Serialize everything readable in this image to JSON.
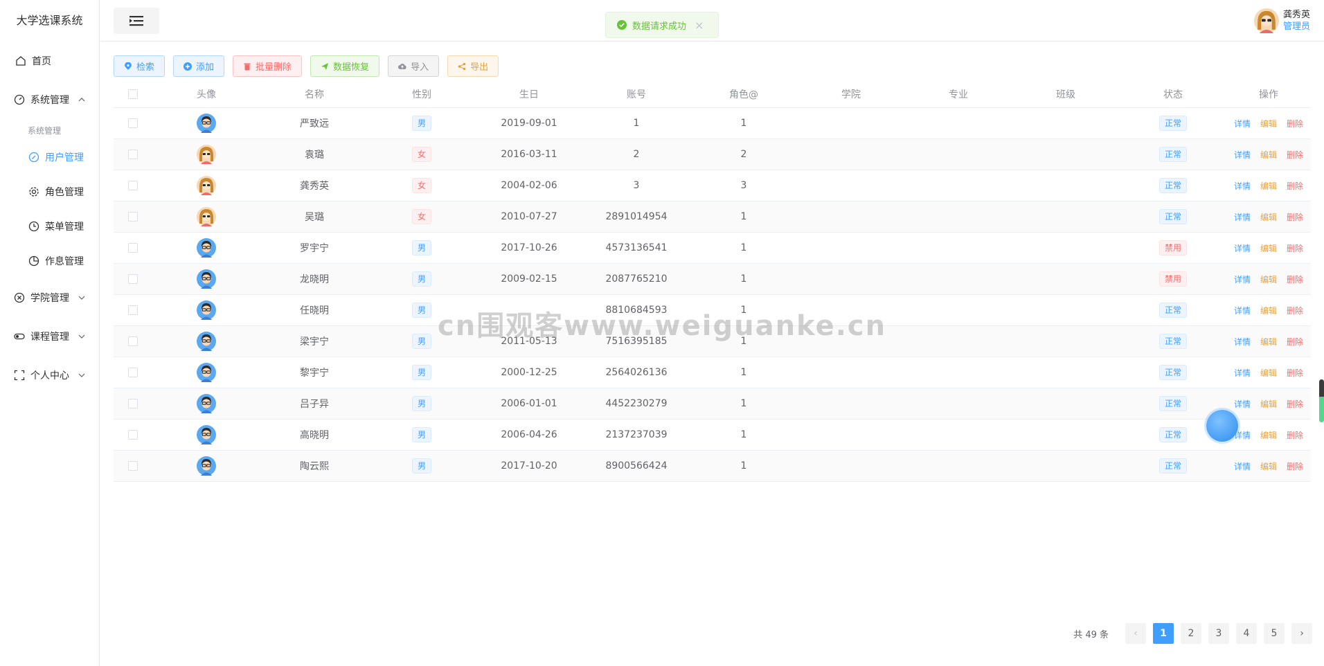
{
  "brand": "大学选课系统",
  "sidebar": {
    "home": "首页",
    "system": "系统管理",
    "system_group_label": "系统管理",
    "user_mgmt": "用户管理",
    "role_mgmt": "角色管理",
    "menu_mgmt": "菜单管理",
    "schedule_mgmt": "作息管理",
    "college_mgmt": "学院管理",
    "course_mgmt": "课程管理",
    "personal": "个人中心"
  },
  "header": {
    "user_name": "龚秀英",
    "user_role": "管理员"
  },
  "toast": {
    "message": "数据请求成功",
    "close": "×"
  },
  "toolbar": {
    "search": "检索",
    "add": "添加",
    "batch_delete": "批量删除",
    "restore": "数据恢复",
    "import": "导入",
    "export": "导出"
  },
  "table": {
    "columns": [
      "头像",
      "名称",
      "性别",
      "生日",
      "账号",
      "角色@",
      "学院",
      "专业",
      "班级",
      "状态",
      "操作"
    ],
    "actions": {
      "detail": "详情",
      "edit": "编辑",
      "delete": "删除"
    },
    "rows": [
      {
        "name": "严致远",
        "gender": "男",
        "birthday": "2019-09-01",
        "account": "1",
        "role": "1",
        "status": "正常"
      },
      {
        "name": "袁璐",
        "gender": "女",
        "birthday": "2016-03-11",
        "account": "2",
        "role": "2",
        "status": "正常"
      },
      {
        "name": "龚秀英",
        "gender": "女",
        "birthday": "2004-02-06",
        "account": "3",
        "role": "3",
        "status": "正常"
      },
      {
        "name": "吴璐",
        "gender": "女",
        "birthday": "2010-07-27",
        "account": "2891014954",
        "role": "1",
        "status": "正常"
      },
      {
        "name": "罗宇宁",
        "gender": "男",
        "birthday": "2017-10-26",
        "account": "4573136541",
        "role": "1",
        "status": "禁用"
      },
      {
        "name": "龙晓明",
        "gender": "男",
        "birthday": "2009-02-15",
        "account": "2087765210",
        "role": "1",
        "status": "禁用"
      },
      {
        "name": "任晓明",
        "gender": "男",
        "birthday": "",
        "account": "8810684593",
        "role": "1",
        "status": "正常"
      },
      {
        "name": "梁宇宁",
        "gender": "男",
        "birthday": "2011-05-13",
        "account": "7516395185",
        "role": "1",
        "status": "正常"
      },
      {
        "name": "黎宇宁",
        "gender": "男",
        "birthday": "2000-12-25",
        "account": "2564026136",
        "role": "1",
        "status": "正常"
      },
      {
        "name": "吕子异",
        "gender": "男",
        "birthday": "2006-01-01",
        "account": "4452230279",
        "role": "1",
        "status": "正常"
      },
      {
        "name": "高晓明",
        "gender": "男",
        "birthday": "2006-04-26",
        "account": "2137237039",
        "role": "1",
        "status": "正常"
      },
      {
        "name": "陶云熙",
        "gender": "男",
        "birthday": "2017-10-20",
        "account": "8900566424",
        "role": "1",
        "status": "正常"
      }
    ]
  },
  "watermark": "cn围观客www.weiguanke.cn",
  "pagination": {
    "total": "共 49 条",
    "prev": "‹",
    "next": "›",
    "pages": [
      "1",
      "2",
      "3",
      "4",
      "5"
    ],
    "current": "1"
  },
  "colors": {
    "primary": "#409eff",
    "success": "#67c23a",
    "danger": "#f56c6c",
    "warning": "#e6a23c"
  }
}
